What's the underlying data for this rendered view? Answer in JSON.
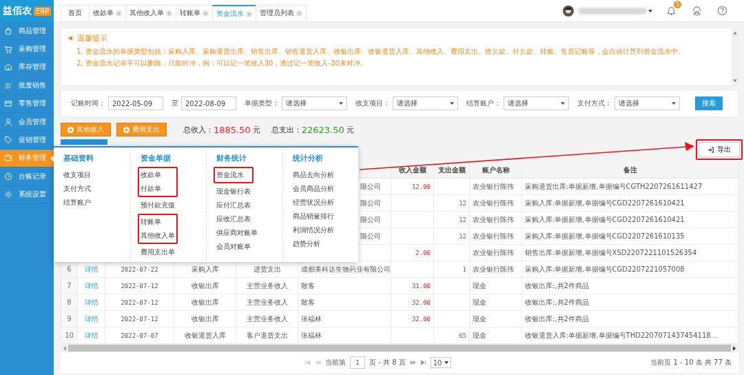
{
  "logo": {
    "name": "益佰农",
    "badge": "ERP"
  },
  "sidebar": {
    "items": [
      {
        "label": "商品管理",
        "selected": false
      },
      {
        "label": "采购管理",
        "selected": false
      },
      {
        "label": "库存管理",
        "selected": false
      },
      {
        "label": "批发销售",
        "selected": false
      },
      {
        "label": "零售管理",
        "selected": false
      },
      {
        "label": "会员管理",
        "selected": false
      },
      {
        "label": "促销管理",
        "selected": false
      },
      {
        "label": "财务管理",
        "selected": true
      },
      {
        "label": "台账记录",
        "selected": false
      },
      {
        "label": "系统设置",
        "selected": false
      }
    ]
  },
  "tabs": [
    {
      "label": "首页",
      "closable": false,
      "selected": false
    },
    {
      "label": "收款单",
      "closable": true,
      "selected": false
    },
    {
      "label": "其他收入单",
      "closable": true,
      "selected": false
    },
    {
      "label": "转账单",
      "closable": true,
      "selected": false
    },
    {
      "label": "资金流水",
      "closable": true,
      "selected": true
    },
    {
      "label": "管理员列表",
      "closable": true,
      "selected": false
    }
  ],
  "header": {
    "notification_count": "5"
  },
  "notice": {
    "title": "温馨提示",
    "lines": [
      "1. 资金流水的单据类型包括：采购入库、采购退货出库、销售出库、销售退货入库、收银出库、收银退货入库、其他收入、费用支出、收欠款、付欠款、转账、售后记账等，会自动计算到资金流水中。",
      "2. 资金流水记录不可以删除，只能对冲，例：可以记一笔收入30，通过记一笔收入-30来对冲。"
    ]
  },
  "filters": [
    {
      "kind": "date",
      "label": "记账时间：",
      "value": "2022-05-09"
    },
    {
      "kind": "date",
      "label": "至",
      "value": "2022-08-09"
    },
    {
      "kind": "select",
      "label": "单据类型：",
      "value": "请选择"
    },
    {
      "kind": "select",
      "label": "收支项目：",
      "value": "请选择"
    },
    {
      "kind": "select",
      "label": "结算账户：",
      "value": "请选择"
    },
    {
      "kind": "select",
      "label": "支付方式：",
      "value": "请选择"
    }
  ],
  "search_button": "搜索",
  "action_buttons": [
    "其他收入",
    "费用支出"
  ],
  "totals": [
    {
      "kind": "income",
      "label": "总收入：",
      "amount": "1885.50",
      "unit": "元"
    },
    {
      "kind": "expense",
      "label": "总支出：",
      "amount": "22623.50",
      "unit": "元"
    }
  ],
  "export_button": {
    "label": "导出",
    "highlighted": true
  },
  "menu": {
    "columns": [
      {
        "title": "基础资料",
        "groups": [
          {
            "highlighted": false,
            "items": [
              "收支项目",
              "支付方式",
              "结算账户"
            ]
          }
        ]
      },
      {
        "title": "资金单据",
        "groups": [
          {
            "highlighted": true,
            "items": [
              "收款单",
              "付款单"
            ]
          },
          {
            "highlighted": false,
            "items": [
              "预付款充值"
            ]
          },
          {
            "highlighted": true,
            "items": [
              "转账单",
              "其他收入单"
            ]
          },
          {
            "highlighted": false,
            "items": [
              "费用支出单"
            ]
          }
        ]
      },
      {
        "title": "财务统计",
        "groups": [
          {
            "highlighted": true,
            "items": [
              "资金流水"
            ]
          },
          {
            "highlighted": false,
            "items": [
              "现金银行表",
              "应付汇总表",
              "应收汇总表",
              "供应商对账单",
              "会员对账单"
            ]
          }
        ]
      },
      {
        "title": "统计分析",
        "groups": [
          {
            "highlighted": false,
            "items": [
              "商品去向分析",
              "会员商品分析",
              "经营状况分析",
              "商品销量排行",
              "利润情况分析",
              "趋势分析"
            ]
          }
        ]
      }
    ]
  },
  "table": {
    "columns": [
      "收入金额",
      "支出金额",
      "账户名称",
      "备注"
    ],
    "rows": [
      {
        "covered": true,
        "partner": "限公司",
        "income": "12.00",
        "account": "农业银行陈伟",
        "note": "采购退货出库:单据新增,单据编号CGTH2207261611427"
      },
      {
        "covered": true,
        "partner": "限公司",
        "expense": "12",
        "account": "农业银行陈伟",
        "note": "采购入库:单据新增,单据编号CGD2207261610421"
      },
      {
        "covered": true,
        "partner": "限公司",
        "expense": "12",
        "account": "农业银行陈伟",
        "note": "采购入库:单据新增,单据编号CGD2207261610421"
      },
      {
        "covered": true,
        "partner": "限公司",
        "expense": "12",
        "account": "农业银行陈伟",
        "note": "采购入库:单据新增,单据编号CGD2207261610135"
      },
      {
        "income": "2.00",
        "account": "农业银行陈伟",
        "note": "销售出库:单据新增,单据编号XSD2207221101526354"
      },
      {
        "no": "6",
        "link": "详情",
        "date": "2022-07-22",
        "type": "采购入库",
        "item": "进货支出",
        "partner": "成都美科达生物药业有限公司",
        "expense": "1",
        "account": "农业银行陈伟",
        "note": "采购入库:单据新增,单据编号CGD2207221057008"
      },
      {
        "no": "7",
        "link": "详情",
        "date": "2022-07-12",
        "type": "收银出库",
        "item": "主营业务收入",
        "partner": "散客",
        "income": "31.00",
        "account": "现金",
        "note": "收银出库:,共2件商品"
      },
      {
        "no": "8",
        "link": "详情",
        "date": "2022-07-12",
        "type": "收银出库",
        "item": "主营业务收入",
        "partner": "散客",
        "income": "32.00",
        "account": "现金",
        "note": "收银出库:,共2件商品"
      },
      {
        "no": "9",
        "link": "详情",
        "date": "2022-07-12",
        "type": "收银出库",
        "item": "主营业务收入",
        "partner": "张福林",
        "income": "32.00",
        "account": "现金",
        "note": "收银出库:,共2件商品"
      },
      {
        "no": "10",
        "link": "详情",
        "date": "2022-07-07",
        "type": "收银退货入库",
        "item": "客户退货支出",
        "partner": "张福林",
        "expense": "65",
        "account": "现金",
        "note": "收银退货入库:单据新增,单据编号THD2207071437454118…"
      }
    ]
  },
  "pagination": {
    "prefix": "当前第",
    "page": "1",
    "suffix": "页 - 共 8 页",
    "page_size": "10",
    "summary": "当前页 1 - 10 条 共 77 条"
  }
}
